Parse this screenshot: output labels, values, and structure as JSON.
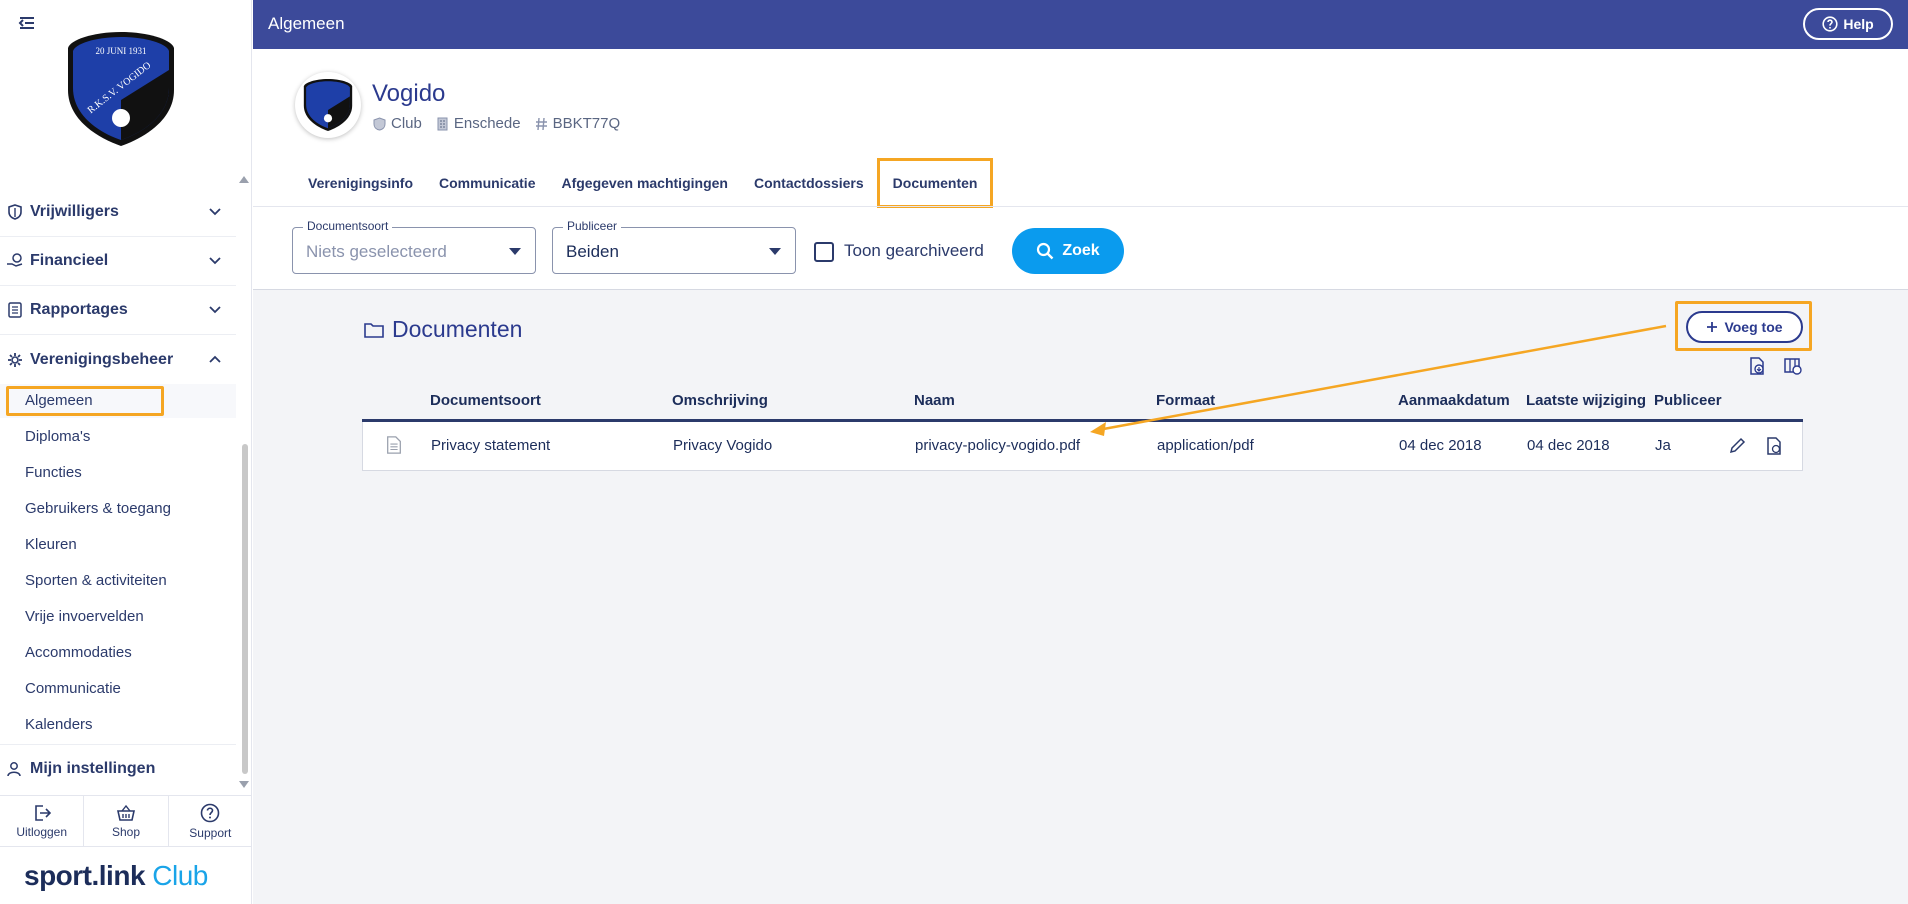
{
  "topbar": {
    "title": "Algemeen",
    "help_label": "Help"
  },
  "sidebar": {
    "sections": [
      {
        "label": "Vrijwilligers",
        "icon": "heart-shield-icon"
      },
      {
        "label": "Financieel",
        "icon": "money-hand-icon"
      },
      {
        "label": "Rapportages",
        "icon": "report-icon"
      },
      {
        "label": "Verenigingsbeheer",
        "icon": "gear-icon"
      }
    ],
    "sub_items": [
      "Algemeen",
      "Diploma's",
      "Functies",
      "Gebruikers & toegang",
      "Kleuren",
      "Sporten & activiteiten",
      "Vrije invoervelden",
      "Accommodaties",
      "Communicatie",
      "Kalenders"
    ],
    "settings_label": "Mijn instellingen",
    "bottom": {
      "logout": "Uitloggen",
      "shop": "Shop",
      "support": "Support"
    },
    "brand_part1": "sport.link",
    "brand_part2": " Club",
    "logo_text_top": "20 JUNI 1931",
    "logo_text_side": "R.K.S.V. VOGIDO"
  },
  "club": {
    "name": "Vogido",
    "type": "Club",
    "city": "Enschede",
    "code": "BBKT77Q"
  },
  "tabs": [
    "Verenigingsinfo",
    "Communicatie",
    "Afgegeven machtigingen",
    "Contactdossiers",
    "Documenten"
  ],
  "filters": {
    "documentsoort_label": "Documentsoort",
    "documentsoort_value": "Niets geselecteerd",
    "publiceer_label": "Publiceer",
    "publiceer_value": "Beiden",
    "archived_label": "Toon gearchiveerd",
    "search_label": "Zoek"
  },
  "documents": {
    "title": "Documenten",
    "add_label": "Voeg toe",
    "columns": [
      "Documentsoort",
      "Omschrijving",
      "Naam",
      "Formaat",
      "Aanmaakdatum",
      "Laatste wijziging",
      "Publiceer"
    ],
    "rows": [
      {
        "documentsoort": "Privacy statement",
        "omschrijving": "Privacy Vogido",
        "naam": "privacy-policy-vogido.pdf",
        "formaat": "application/pdf",
        "aanmaakdatum": "04 dec 2018",
        "laatste_wijziging": "04 dec 2018",
        "publiceer": "Ja"
      }
    ]
  },
  "colors": {
    "primary": "#3c4a9a",
    "accent": "#0a9bee",
    "highlight": "#f5a623",
    "text": "#1c2d5a"
  }
}
